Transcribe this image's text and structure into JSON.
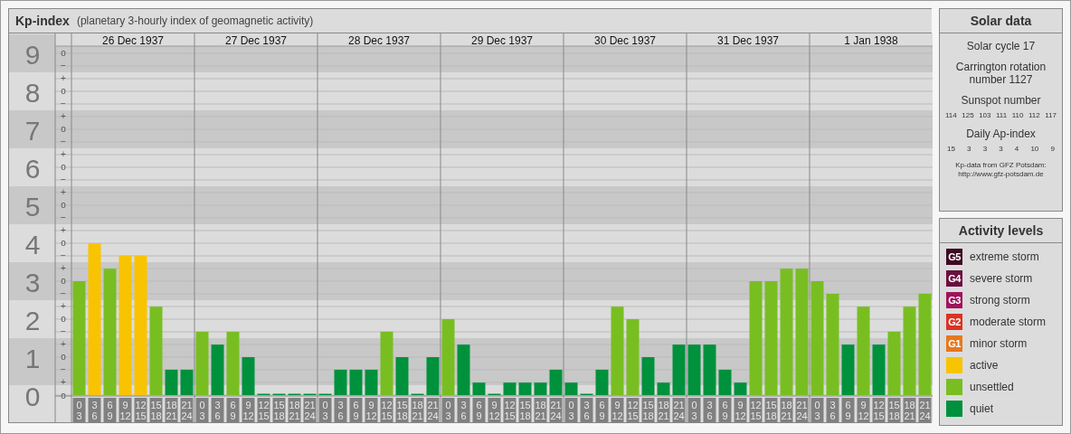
{
  "kp_chart": {
    "title": "Kp-index",
    "subtitle": "(planetary 3-hourly index of geomagnetic activity)",
    "days": [
      "26 Dec 1937",
      "27 Dec 1937",
      "28 Dec 1937",
      "29 Dec 1937",
      "30 Dec 1937",
      "31 Dec 1937",
      "1 Jan 1938"
    ],
    "minor_ticks": [
      "o",
      "−",
      "+",
      "o",
      "−",
      "+",
      "o",
      "−",
      "+",
      "o",
      "−",
      "+",
      "o",
      "−",
      "+",
      "o",
      "−",
      "+",
      "o",
      "−",
      "+",
      "o",
      "−",
      "+",
      "o",
      "−",
      "+",
      "o"
    ],
    "chart_data": {
      "type": "bar",
      "grid": true,
      "ylim": [
        0,
        9.19
      ],
      "categories": [
        "0\n3",
        "3\n6",
        "6\n9",
        "9\n12",
        "12\n15",
        "15\n18",
        "18\n21",
        "21\n24",
        "0\n3",
        "3\n6",
        "6\n9",
        "9\n12",
        "12\n15",
        "15\n18",
        "18\n21",
        "21\n24",
        "0\n3",
        "3\n6",
        "6\n9",
        "9\n12",
        "12\n15",
        "15\n18",
        "18\n21",
        "21\n24",
        "0\n3",
        "3\n6",
        "6\n9",
        "9\n12",
        "12\n15",
        "15\n18",
        "18\n21",
        "21\n24",
        "0\n3",
        "3\n6",
        "6\n9",
        "9\n12",
        "12\n15",
        "15\n18",
        "18\n21",
        "21\n24",
        "0\n3",
        "3\n6",
        "6\n9",
        "9\n12",
        "12\n15",
        "15\n18",
        "18\n21",
        "21\n24",
        "0\n3",
        "3\n6",
        "6\n9",
        "9\n12",
        "12\n15",
        "15\n18",
        "18\n21",
        "21\n24"
      ],
      "yticks": [
        9,
        8,
        7,
        6,
        5,
        4,
        3,
        2,
        1,
        0
      ],
      "series": [
        {
          "color": "#00913c",
          "values": [
            null,
            null,
            null,
            null,
            null,
            null,
            0.67,
            0.67,
            null,
            1.33,
            null,
            1,
            0,
            0,
            0,
            0,
            0,
            0.67,
            0.67,
            0.67,
            null,
            1,
            0,
            1,
            null,
            1.33,
            0.33,
            0,
            0.33,
            0.33,
            0.33,
            0.67,
            0.33,
            0,
            0.67,
            null,
            null,
            1,
            0.33,
            1.33,
            1.33,
            1.33,
            0.67,
            0.33,
            null,
            null,
            null,
            null,
            null,
            null,
            1.33,
            null,
            1.33,
            null,
            null,
            null
          ]
        },
        {
          "color": "#78be21",
          "values": [
            3,
            null,
            3.33,
            null,
            null,
            2.33,
            null,
            null,
            1.67,
            null,
            1.67,
            null,
            null,
            null,
            null,
            null,
            null,
            null,
            null,
            null,
            1.67,
            null,
            null,
            null,
            2,
            null,
            null,
            null,
            null,
            null,
            null,
            null,
            null,
            null,
            null,
            2.33,
            2,
            null,
            null,
            null,
            null,
            null,
            null,
            null,
            3,
            3,
            3.33,
            3.33,
            3,
            2.67,
            null,
            2.33,
            null,
            1.67,
            2.33,
            2.67
          ]
        },
        {
          "color": "#f8c300",
          "values": [
            null,
            4,
            null,
            3.67,
            3.67,
            null,
            null,
            null,
            null,
            null,
            null,
            null,
            null,
            null,
            null,
            null,
            null,
            null,
            null,
            null,
            null,
            null,
            null,
            null,
            null,
            null,
            null,
            null,
            null,
            null,
            null,
            null,
            null,
            null,
            null,
            null,
            null,
            null,
            null,
            null,
            null,
            null,
            null,
            null,
            null,
            null,
            null,
            null,
            null,
            null,
            null,
            null,
            null,
            null,
            null,
            null
          ]
        }
      ]
    }
  },
  "solar_data": {
    "title": "Solar data",
    "solar_cycle": "Solar cycle 17",
    "carrington": "Carrington rotation number 1127",
    "sunspot_heading": "Sunspot number",
    "sunspot_numbers": [
      "114",
      "125",
      "103",
      "111",
      "110",
      "112",
      "117"
    ],
    "ap_heading": "Daily Ap-index",
    "ap_values": [
      "15",
      "3",
      "3",
      "3",
      "4",
      "10",
      "9"
    ],
    "credit": [
      "Kp-data from GFZ Potsdam:",
      "http://www.gfz-potsdam.de"
    ]
  },
  "activity_levels": {
    "title": "Activity levels",
    "items": [
      {
        "badge": "G5",
        "label": "extreme storm",
        "color": "#3e0a22"
      },
      {
        "badge": "G4",
        "label": "severe storm",
        "color": "#6b0f3e"
      },
      {
        "badge": "G3",
        "label": "strong storm",
        "color": "#a0135a"
      },
      {
        "badge": "G2",
        "label": "moderate storm",
        "color": "#dc3222"
      },
      {
        "badge": "G1",
        "label": "minor storm",
        "color": "#e6781e"
      },
      {
        "label": "active",
        "color": "#f8c300"
      },
      {
        "label": "unsettled",
        "color": "#78be21"
      },
      {
        "label": "quiet",
        "color": "#00913c"
      }
    ]
  }
}
